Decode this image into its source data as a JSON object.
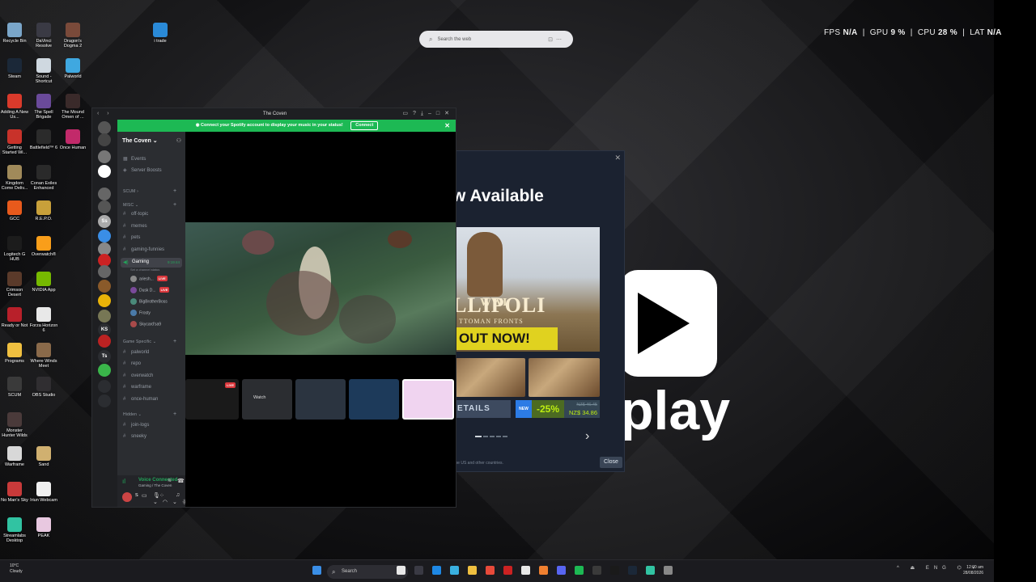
{
  "desktop": {
    "icons": [
      {
        "label": "Recycle Bin",
        "color": "#7aa6c9"
      },
      {
        "label": "DaVinci Resolve",
        "color": "#3a3a44"
      },
      {
        "label": "Dragon's Dogma 2",
        "color": "#7a4a3a"
      },
      {
        "label": "Steam",
        "color": "#1b2838"
      },
      {
        "label": "Sound - Shortcut",
        "color": "#cfd8e0"
      },
      {
        "label": "Palworld",
        "color": "#3fa8e0"
      },
      {
        "label": "Adding A New Us...",
        "color": "#d93a2b"
      },
      {
        "label": "The Spell Brigade",
        "color": "#6a4a9a"
      },
      {
        "label": "The Mound Omen of ...",
        "color": "#3a2a2a"
      },
      {
        "label": "Getting Started Wi...",
        "color": "#c8322a"
      },
      {
        "label": "Battlefield™ 6",
        "color": "#2b2b2b"
      },
      {
        "label": "Once Human",
        "color": "#c22a6a"
      },
      {
        "label": "Kingdom Come Deliv...",
        "color": "#a08a5a"
      },
      {
        "label": "Conan Exiles Enhanced",
        "color": "#2a2a2a"
      },
      {
        "label": "GCC",
        "color": "#e85a1c"
      },
      {
        "label": "R.E.P.O.",
        "color": "#c8a03a"
      },
      {
        "label": "Logitech G HUB",
        "color": "#1c1c1c"
      },
      {
        "label": "Overwatch®",
        "color": "#f99e1a"
      },
      {
        "label": "Crimson Desert",
        "color": "#5a3a2a"
      },
      {
        "label": "NVIDIA App",
        "color": "#76b900"
      },
      {
        "label": "Ready or Not",
        "color": "#b8202a"
      },
      {
        "label": "Forza Horizon 6",
        "color": "#e8e8e8"
      },
      {
        "label": "Programs",
        "color": "#f0c040"
      },
      {
        "label": "Where Winds Meet",
        "color": "#8a6a4a"
      },
      {
        "label": "SCUM",
        "color": "#3a3a3a"
      },
      {
        "label": "OBS Studio",
        "color": "#302e31"
      },
      {
        "label": "Monster Hunter Wilds",
        "color": "#4a3a3a"
      },
      {
        "label": "Warframe",
        "color": "#d8d8d8"
      },
      {
        "label": "Sand",
        "color": "#d0b070"
      },
      {
        "label": "No Man's Sky",
        "color": "#c83a3a"
      },
      {
        "label": "Iriun Webcam",
        "color": "#f0f0f0"
      },
      {
        "label": "Streamlabs Desktop",
        "color": "#31c3a2"
      },
      {
        "label": "PEAK",
        "color": "#e8c8e0"
      },
      {
        "label": "i trade",
        "color": "#2a8ad8"
      }
    ]
  },
  "websearch": {
    "placeholder": "Search the web"
  },
  "perf": {
    "fps_label": "FPS",
    "fps": "N/A",
    "gpu_label": "GPU",
    "gpu": "9 %",
    "cpu_label": "CPU",
    "cpu": "28 %",
    "lat_label": "LAT",
    "lat": "N/A"
  },
  "wallpaper": {
    "brand_text": "play"
  },
  "steam_popup": {
    "heading": "w Available",
    "banner": {
      "line1": "WWI",
      "line2": "LLIPOLI",
      "line3": "TTOMAN FRONTS",
      "line4": "OUT NOW!"
    },
    "details_label": "ETAILS",
    "new_badge": "NEW",
    "discount": "-25%",
    "old_price": "NZ$ 46.45",
    "price": "NZ$ 34.86",
    "footer": "the US and other countries.",
    "close_label": "Close"
  },
  "discord": {
    "window_title": "The Coven",
    "spotify_banner": "Connect your Spotify account to display your music in your status!",
    "spotify_connect": "Connect",
    "server_name": "The Coven",
    "top_items": [
      "Events",
      "Server Boosts"
    ],
    "cat_scum": "SCUM",
    "cat_misc": "MISC",
    "channels_misc": [
      "off-topic",
      "memes",
      "pets",
      "gaming-funnies"
    ],
    "voice_channel": "Gaming",
    "voice_timer": "9:19:44",
    "voice_users": [
      {
        "name": "ariesh...",
        "live": true,
        "color": "#8a8a8a"
      },
      {
        "name": "Dusk D...",
        "live": true,
        "color": "#7a4a9a"
      },
      {
        "name": "BigBrotherBoss",
        "live": false,
        "color": "#4a8a7a"
      },
      {
        "name": "Frosty",
        "live": false,
        "color": "#4a7aa8"
      },
      {
        "name": "Skycard'sa9",
        "live": false,
        "color": "#a84a4a"
      }
    ],
    "live_label": "LIVE",
    "cat_game": "Game Specific",
    "channels_game": [
      "palworld",
      "repo",
      "overwatch",
      "warframe",
      "once-human"
    ],
    "cat_hidden": "Hidden",
    "channels_hidden": [
      "join-logs",
      "sneeky"
    ],
    "status_hint": "Set a channel status",
    "voice_connected": "Voice Connected",
    "voice_location": "Gaming / The Coven",
    "user_short": "S",
    "guild_text": [
      "Ss",
      "KS",
      "Ts"
    ],
    "watch_label": "Watch",
    "tile_live": "LIVE"
  },
  "taskbar": {
    "weather_temp": "10°C",
    "weather_desc": "Cloudy",
    "search_label": "Search",
    "tray_lang": "ENG",
    "time": "12:00 am",
    "date": "28/08/2026"
  }
}
